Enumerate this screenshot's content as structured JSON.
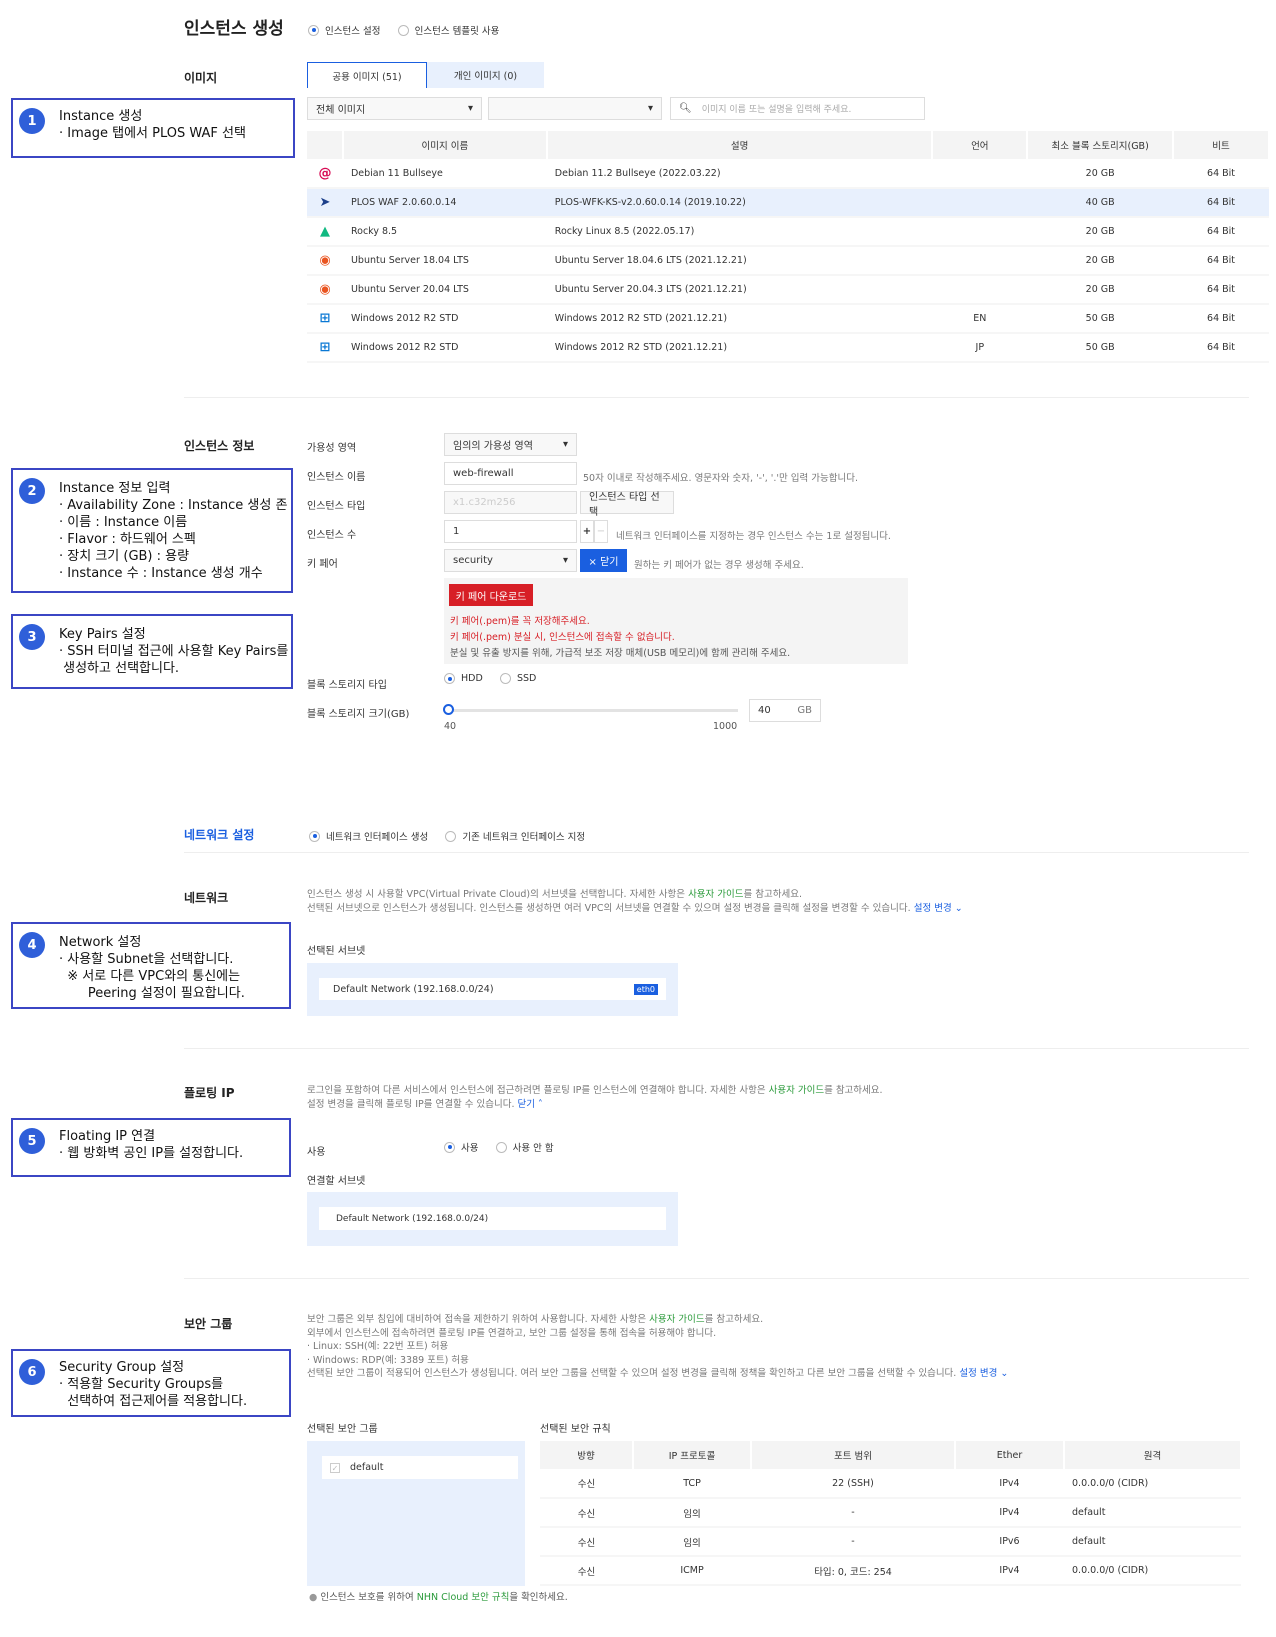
{
  "page": {
    "title": "인스턴스 생성",
    "mode_options": [
      "인스턴스 설정",
      "인스턴스 템플릿 사용"
    ],
    "mode_selected": 0
  },
  "image": {
    "label": "이미지",
    "tabs": [
      "공용 이미지 (51)",
      "개인 이미지 (0)"
    ],
    "active_tab": 0,
    "filter1": "전체 이미지",
    "filter2": "",
    "search_placeholder": "이미지 이름 또는 설명을 입력해 주세요.",
    "columns": [
      "이미지 이름",
      "설명",
      "언어",
      "최소 블록 스토리지(GB)",
      "비트"
    ],
    "rows": [
      {
        "icon": "debian-icon",
        "name": "Debian 11 Bullseye",
        "desc": "Debian 11.2 Bullseye (2022.03.22)",
        "lang": "",
        "storage": "20 GB",
        "bit": "64 Bit"
      },
      {
        "icon": "plos-icon",
        "name": "PLOS WAF 2.0.60.0.14",
        "desc": "PLOS-WFK-KS-v2.0.60.0.14 (2019.10.22)",
        "lang": "",
        "storage": "40 GB",
        "bit": "64 Bit",
        "selected": true
      },
      {
        "icon": "rocky-icon",
        "name": "Rocky 8.5",
        "desc": "Rocky Linux 8.5 (2022.05.17)",
        "lang": "",
        "storage": "20 GB",
        "bit": "64 Bit"
      },
      {
        "icon": "ubuntu-icon",
        "name": "Ubuntu Server 18.04 LTS",
        "desc": "Ubuntu Server 18.04.6 LTS (2021.12.21)",
        "lang": "",
        "storage": "20 GB",
        "bit": "64 Bit"
      },
      {
        "icon": "ubuntu-icon",
        "name": "Ubuntu Server 20.04 LTS",
        "desc": "Ubuntu Server 20.04.3 LTS (2021.12.21)",
        "lang": "",
        "storage": "20 GB",
        "bit": "64 Bit"
      },
      {
        "icon": "windows-icon",
        "name": "Windows 2012 R2 STD",
        "desc": "Windows 2012 R2 STD (2021.12.21)",
        "lang": "EN",
        "storage": "50 GB",
        "bit": "64 Bit"
      },
      {
        "icon": "windows-icon",
        "name": "Windows 2012 R2 STD",
        "desc": "Windows 2012 R2 STD (2021.12.21)",
        "lang": "JP",
        "storage": "50 GB",
        "bit": "64 Bit"
      }
    ]
  },
  "instance": {
    "label": "인스턴스 정보",
    "az_label": "가용성 영역",
    "az_value": "임의의 가용성 영역",
    "name_label": "인스턴스 이름",
    "name_value": "web-firewall",
    "name_hint": "50자 이내로 작성해주세요. 영문자와 숫자, '-', '.'만 입력 가능합니다.",
    "type_label": "인스턴스 타입",
    "type_placeholder": "x1.c32m256",
    "type_button": "인스턴스 타입 선택",
    "count_label": "인스턴스 수",
    "count_value": "1",
    "count_plus": "+",
    "count_minus": "−",
    "count_hint": "네트워크 인터페이스를 지정하는 경우 인스턴스 수는 1로 설정됩니다.",
    "keypair_label": "키 페어",
    "keypair_value": "security",
    "keypair_close": "× 닫기",
    "keypair_hint": "원하는 키 페어가 없는 경우 생성해 주세요.",
    "keypair_download": "키 페어 다운로드",
    "keypair_warn1": "키 페어(.pem)를 꼭 저장해주세요.",
    "keypair_warn2": "키 페어(.pem) 분실 시, 인스턴스에 접속할 수 없습니다.",
    "keypair_note": "분실 및 유출 방지를 위해, 가급적 보조 저장 매체(USB 메모리)에 함께 관리해 주세요.",
    "storage_type_label": "블록 스토리지 타입",
    "storage_types": [
      "HDD",
      "SSD"
    ],
    "storage_type_selected": 0,
    "storage_size_label": "블록 스토리지 크기(GB)",
    "storage_min": "40",
    "storage_max": "1000",
    "storage_value": "40",
    "storage_unit": "GB",
    "slider_fraction": 0
  },
  "network": {
    "label": "네트워크 설정",
    "options": [
      "네트워크 인터페이스 생성",
      "기존 네트워크 인터페이스 지정"
    ],
    "selected": 0,
    "sub_label": "네트워크",
    "desc1_a": "인스턴스 생성 시 사용할 VPC(Virtual Private Cloud)의 서브넷을 선택합니다. 자세한 사항은 ",
    "guide": "사용자 가이드",
    "desc1_b": "를 참고하세요.",
    "desc2": "선택된 서브넷으로 인스턴스가 생성됩니다. 인스턴스를 생성하면 여러 VPC의 서브넷을 연결할 수 있으며 설정 변경을 클릭해 설정을 변경할 수 있습니다.",
    "change": "설정 변경",
    "subnet_label": "선택된 서브넷",
    "subnet": "Default Network (192.168.0.0/24)",
    "nic": "eth0"
  },
  "floating": {
    "label": "플로팅 IP",
    "desc1_a": "로그인을 포함하여 다른 서비스에서 인스턴스에 접근하려면 플로팅 IP를 인스턴스에 연결해야 합니다. 자세한 사항은 ",
    "guide": "사용자 가이드",
    "desc1_b": "를 참고하세요.",
    "desc2": "설정 변경을 클릭해 플로팅 IP를 연결할 수 있습니다.",
    "close": "닫기",
    "use_label": "사용",
    "options": [
      "사용",
      "사용 안 함"
    ],
    "selected": 0,
    "subnet_label": "연결할 서브넷",
    "subnet": "Default Network (192.168.0.0/24)"
  },
  "security": {
    "label": "보안 그룹",
    "desc1_a": "보안 그룹은 외부 침입에 대비하여 접속을 제한하기 위하여 사용합니다. 자세한 사항은 ",
    "guide": "사용자 가이드",
    "desc1_b": "를 참고하세요.",
    "desc2": "외부에서 인스턴스에 접속하려면 플로팅 IP를 연결하고, 보안 그룹 설정을 통해 접속을 허용해야 합니다.",
    "desc3": "· Linux: SSH(예: 22번 포트) 허용",
    "desc4": "· Windows: RDP(예: 3389 포트) 허용",
    "desc5": "선택된 보안 그룹이 적용되어 인스턴스가 생성됩니다. 여러 보안 그룹을 선택할 수 있으며 설정 변경을 클릭해 정책을 확인하고 다른 보안 그룹을 선택할 수 있습니다.",
    "change": "설정 변경",
    "group_label": "선택된 보안 그룹",
    "group": "default",
    "rules_label": "선택된 보안 규칙",
    "columns": [
      "방향",
      "IP 프로토콜",
      "포트 범위",
      "Ether",
      "원격"
    ],
    "rules": [
      [
        "수신",
        "TCP",
        "22 (SSH)",
        "IPv4",
        "0.0.0.0/0 (CIDR)"
      ],
      [
        "수신",
        "임의",
        "-",
        "IPv4",
        "default"
      ],
      [
        "수신",
        "임의",
        "-",
        "IPv6",
        "default"
      ],
      [
        "수신",
        "ICMP",
        "타입: 0, 코드: 254",
        "IPv4",
        "0.0.0.0/0 (CIDR)"
      ]
    ],
    "note_a": "인스턴스 보호를 위하여 ",
    "note_link": "NHN Cloud 보안 규칙",
    "note_b": "을 확인하세요."
  },
  "annotations": [
    {
      "num": "1",
      "lines": [
        "Instance 생성",
        "· Image 탭에서 PLOS WAF 선택"
      ]
    },
    {
      "num": "2",
      "lines": [
        "Instance 정보 입력",
        "· Availability Zone : Instance 생성 존",
        "· 이름 : Instance 이름",
        "· Flavor : 하드웨어 스펙",
        "· 장치 크기 (GB) : 용량",
        "· Instance 수 : Instance 생성 개수"
      ]
    },
    {
      "num": "3",
      "lines": [
        "Key Pairs 설정",
        "· SSH 터미널 접근에 사용할 Key Pairs를",
        " 생성하고 선택합니다."
      ]
    },
    {
      "num": "4",
      "lines": [
        "Network 설정",
        "· 사용할 Subnet을 선택합니다.",
        "  ※ 서로 다른 VPC와의 통신에는",
        "       Peering 설정이 필요합니다."
      ]
    },
    {
      "num": "5",
      "lines": [
        "Floating IP 연결",
        "· 웹 방화벽 공인 IP를 설정합니다."
      ]
    },
    {
      "num": "6",
      "lines": [
        "Security Group 설정",
        "· 적용할 Security Groups를",
        "  선택하여 접근제어를 적용합니다."
      ]
    }
  ],
  "colors": {
    "accent": "#1a5fe0",
    "annotation_border": "#3b46c4",
    "danger": "#d71f26",
    "link_green": "#2a9a3a",
    "selected_row": "#e8f0fd"
  }
}
